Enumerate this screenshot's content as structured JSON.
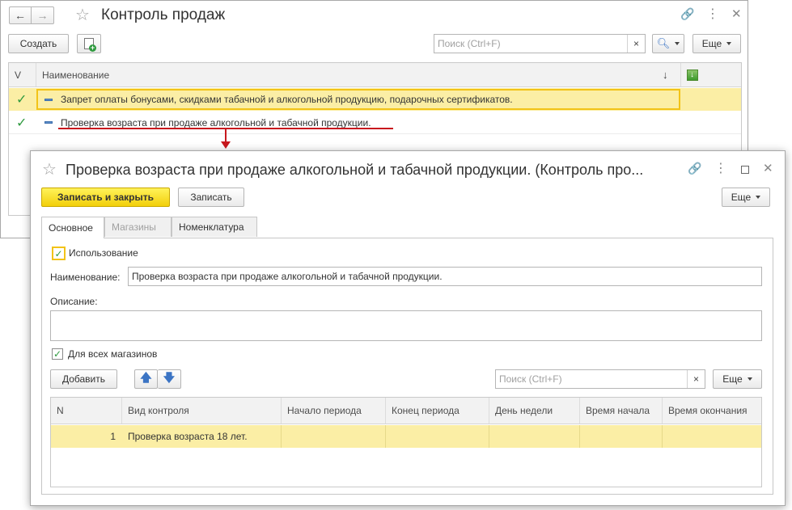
{
  "back_window": {
    "title": "Контроль продаж",
    "create_label": "Создать",
    "search_placeholder": "Поиск (Ctrl+F)",
    "more_label": "Еще",
    "columns": {
      "v": "V",
      "name": "Наименование"
    },
    "rows": [
      {
        "name": "Запрет оплаты бонусами, скидками табачной и алкогольной продукцию, подарочных сертификатов."
      },
      {
        "name": "Проверка возраста при продаже алкогольной и табачной продукции."
      }
    ]
  },
  "front_window": {
    "title": "Проверка возраста при продаже алкогольной и табачной продукции. (Контроль про...",
    "save_close_label": "Записать и закрыть",
    "save_label": "Записать",
    "more_label": "Еще",
    "tabs": [
      "Основное",
      "Магазины",
      "Номенклатура"
    ],
    "usage_label": "Использование",
    "name_label": "Наименование:",
    "name_value": "Проверка возраста при продаже алкогольной и табачной продукции.",
    "description_label": "Описание:",
    "description_value": "",
    "all_stores_label": "Для всех магазинов",
    "add_label": "Добавить",
    "search_placeholder": "Поиск (Ctrl+F)",
    "more2_label": "Еще",
    "table": {
      "columns": [
        "N",
        "Вид контроля",
        "Начало периода",
        "Конец периода",
        "День недели",
        "Время начала",
        "Время окончания"
      ],
      "rows": [
        {
          "n": "1",
          "kind": "Проверка возраста 18 лет.",
          "start": "",
          "end": "",
          "weekday": "",
          "time_start": "",
          "time_end": ""
        }
      ]
    }
  },
  "colors": {
    "accent_yellow": "#f2cf0a",
    "selected_row": "#fbeea5",
    "arrow_red": "#c8181e",
    "check_green": "#2f9a3f"
  }
}
